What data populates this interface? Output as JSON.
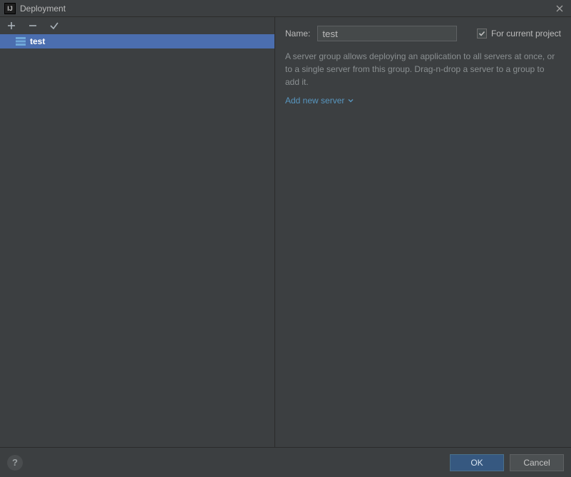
{
  "window": {
    "title": "Deployment",
    "app_icon_text": "IJ"
  },
  "toolbar": {
    "add_tooltip": "Add",
    "remove_tooltip": "Remove",
    "apply_tooltip": "Apply"
  },
  "tree": {
    "items": [
      {
        "label": "test",
        "selected": true
      }
    ]
  },
  "form": {
    "name_label": "Name:",
    "name_value": "test",
    "for_current_project_label": "For current project",
    "for_current_project_checked": true,
    "description": "A server group allows deploying an application to all servers at once, or to a single server from this group. Drag-n-drop a server to a group to add it.",
    "add_new_server_label": "Add new server"
  },
  "footer": {
    "help_label": "?",
    "ok_label": "OK",
    "cancel_label": "Cancel"
  }
}
